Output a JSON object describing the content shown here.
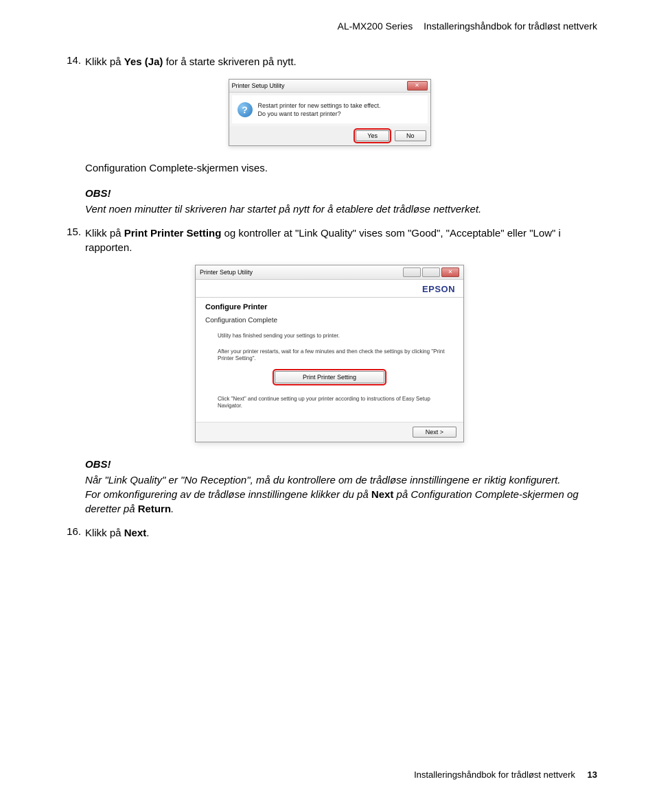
{
  "header": {
    "series": "AL-MX200 Series",
    "doc_title": "Installeringshåndbok for trådløst nettverk"
  },
  "steps": {
    "s14": {
      "num": "14.",
      "pre": "Klikk på ",
      "bold": "Yes (Ja)",
      "post": " for å starte skriveren på nytt."
    },
    "s15": {
      "num": "15.",
      "pre": "Klikk på ",
      "bold": "Print Printer Setting",
      "post": " og kontroller at \"Link Quality\" vises som \"Good\", \"Acceptable\" eller \"Low\" i rapporten."
    },
    "s16": {
      "num": "16.",
      "pre": "Klikk på ",
      "bold": "Next",
      "post": "."
    }
  },
  "after14": {
    "line": "Configuration Complete-skjermen vises.",
    "obs_heading": "OBS!",
    "obs_body": "Vent noen minutter til skriveren har startet på nytt for å etablere det trådløse nettverket."
  },
  "dialog1": {
    "title": "Printer Setup Utility",
    "msg1": "Restart printer for new settings to take effect.",
    "msg2": "Do you want to restart printer?",
    "yes": "Yes",
    "no": "No"
  },
  "dialog2": {
    "title": "Printer Setup Utility",
    "brand": "EPSON",
    "h1": "Configure Printer",
    "h2": "Configuration Complete",
    "line1": "Utility has finished sending your settings to printer.",
    "line2": "After your printer restarts, wait for a few minutes and then check the settings by clicking \"Print Printer Setting\".",
    "print_btn": "Print Printer Setting",
    "line3": "Click \"Next\" and continue setting up your printer according to instructions of Easy Setup Navigator.",
    "next": "Next >"
  },
  "after15": {
    "obs_heading": "OBS!",
    "obs_body1": "Når \"Link Quality\" er \"No Reception\", må du kontrollere om de trådløse innstillingene er riktig konfigurert.",
    "obs_body2_pre": "For omkonfigurering av de trådløse innstillingene klikker du på ",
    "obs_body2_bold1": "Next",
    "obs_body2_mid": " på Configuration Complete-skjermen og deretter på ",
    "obs_body2_bold2": "Return",
    "obs_body2_post": "."
  },
  "footer": {
    "text": "Installeringshåndbok for trådløst nettverk",
    "page": "13"
  }
}
